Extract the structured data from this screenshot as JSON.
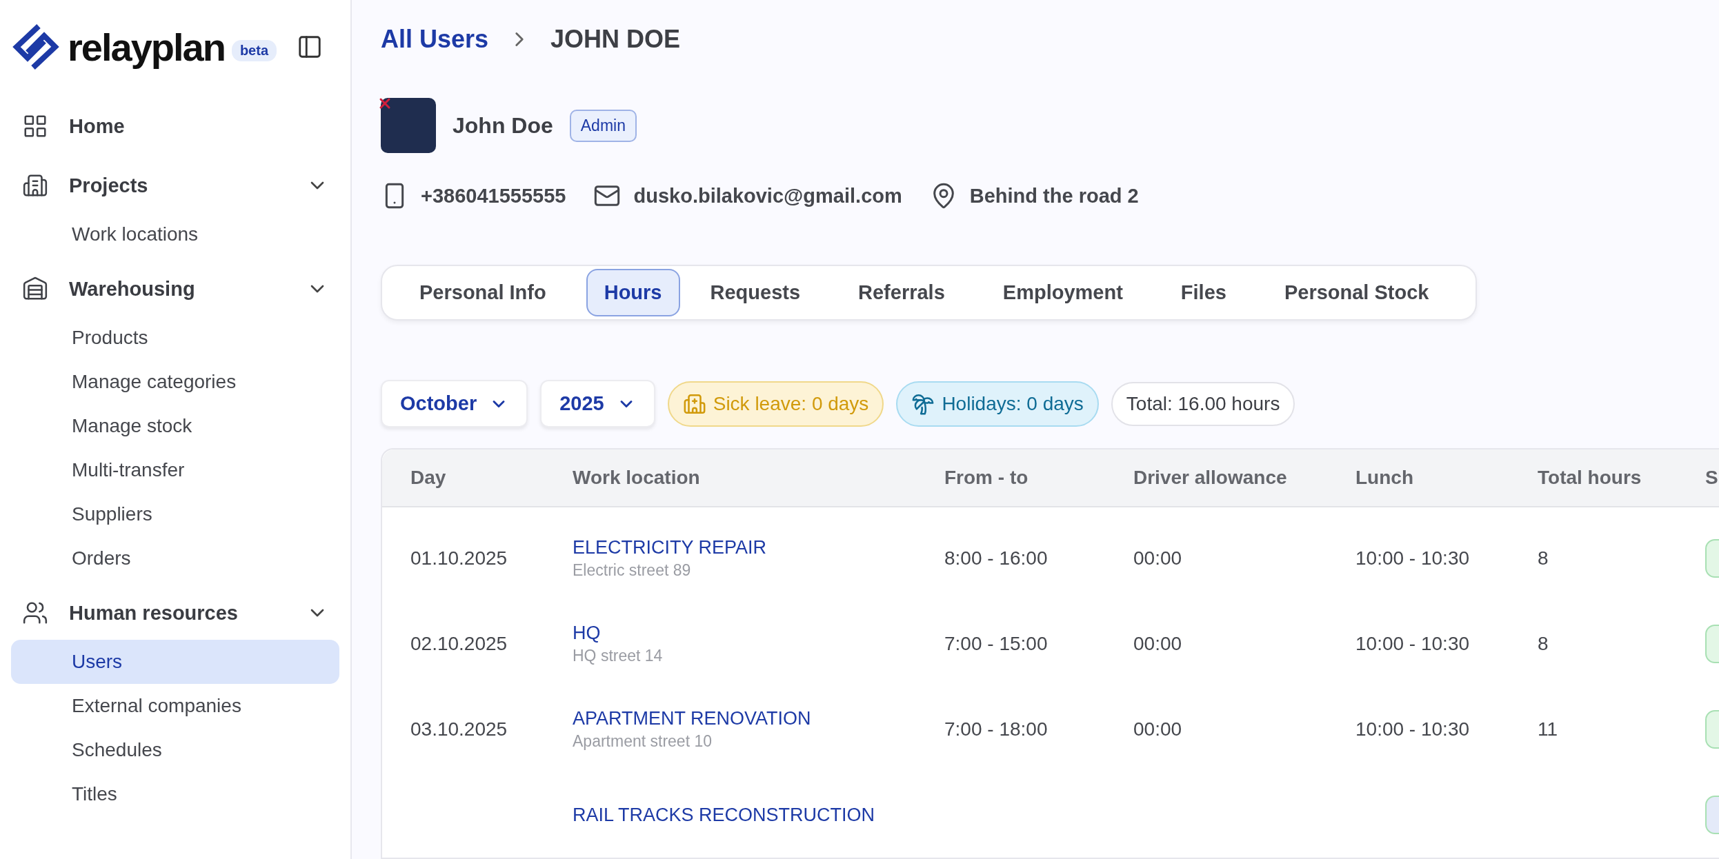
{
  "sidebar": {
    "logo": "relayplan",
    "badge": "beta",
    "nav": [
      {
        "kind": "link",
        "label": "Home"
      },
      {
        "kind": "group",
        "label": "Projects",
        "expanded": true,
        "children": [
          {
            "label": "Work locations",
            "selected": false
          }
        ]
      },
      {
        "kind": "group",
        "label": "Warehousing",
        "expanded": true,
        "children": [
          {
            "label": "Products",
            "selected": false
          },
          {
            "label": "Manage categories",
            "selected": false
          },
          {
            "label": "Manage stock",
            "selected": false
          },
          {
            "label": "Multi-transfer",
            "selected": false
          },
          {
            "label": "Suppliers",
            "selected": false
          },
          {
            "label": "Orders",
            "selected": false
          }
        ]
      },
      {
        "kind": "group",
        "label": "Human resources",
        "expanded": true,
        "children": [
          {
            "label": "Users",
            "selected": true
          },
          {
            "label": "External companies",
            "selected": false
          },
          {
            "label": "Schedules",
            "selected": false
          },
          {
            "label": "Titles",
            "selected": false
          }
        ]
      }
    ]
  },
  "breadcrumb": [
    "All Users",
    "JOHN DOE"
  ],
  "profile": {
    "name": "John Doe",
    "role": "Admin",
    "contacts": [
      {
        "kind": "phone",
        "text": "+386041555555"
      },
      {
        "kind": "email",
        "text": "dusko.bilakovic@gmail.com"
      },
      {
        "kind": "address",
        "text": "Behind the road 2"
      }
    ]
  },
  "tabs": [
    {
      "label": "Personal Info",
      "selected": false
    },
    {
      "label": "Hours",
      "selected": true
    },
    {
      "label": "Requests",
      "selected": false
    },
    {
      "label": "Referrals",
      "selected": false
    },
    {
      "label": "Employment",
      "selected": false
    },
    {
      "label": "Files",
      "selected": false
    },
    {
      "label": "Personal Stock",
      "selected": false
    }
  ],
  "filters": {
    "month": "October",
    "year": "2025",
    "chips": [
      {
        "kind": "sick",
        "text": "Sick leave: 0 days"
      },
      {
        "kind": "holiday",
        "text": "Holidays: 0 days"
      },
      {
        "kind": "total",
        "text": "Total: 16.00 hours"
      }
    ]
  },
  "table": {
    "columns": [
      "Day",
      "Work location",
      "From - to",
      "Driver allowance",
      "Lunch",
      "Total hours",
      "S"
    ],
    "rows": [
      {
        "day": "01.10.2025",
        "location": "ELECTRICITY REPAIR",
        "address": "Electric street 89",
        "from_to": "8:00 - 16:00",
        "driver_allowance": "00:00",
        "lunch": "10:00 - 10:30",
        "total_hours": "8",
        "color": "#e3f7e6"
      },
      {
        "day": "02.10.2025",
        "location": "HQ",
        "address": "HQ street 14",
        "from_to": "7:00 - 15:00",
        "driver_allowance": "00:00",
        "lunch": "10:00 - 10:30",
        "total_hours": "8",
        "color": "#e3f7e6"
      },
      {
        "day": "03.10.2025",
        "location": "APARTMENT RENOVATION",
        "address": "Apartment street 10",
        "from_to": "7:00 - 18:00",
        "driver_allowance": "00:00",
        "lunch": "10:00 - 10:30",
        "total_hours": "11",
        "color": "#e3f7e6"
      },
      {
        "location": "RAIL TRACKS RECONSTRUCTION",
        "color": "#e4eaf9"
      }
    ]
  }
}
